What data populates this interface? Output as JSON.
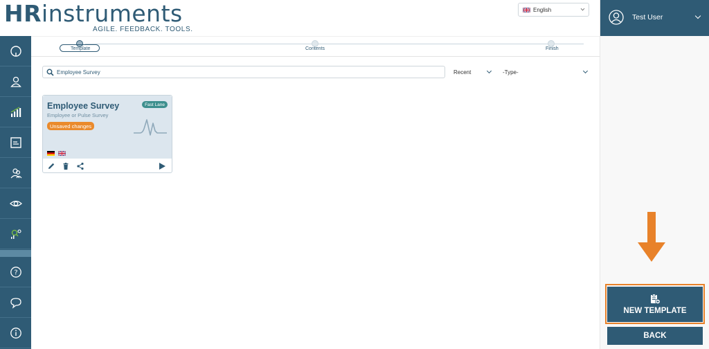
{
  "brand": {
    "logo_text": "HRinstruments",
    "tagline": "AGILE. FEEDBACK. TOOLS.",
    "accent_color": "#e2671b",
    "primary_color": "#2f5b75"
  },
  "language": {
    "selected": "English",
    "flag_icon": "uk-flag-icon"
  },
  "user": {
    "name": "Test User",
    "avatar_icon": "user-avatar-icon"
  },
  "sidebar": {
    "items": [
      {
        "name": "dashboard",
        "icon": "circle-icon"
      },
      {
        "name": "participants",
        "icon": "person-icon"
      },
      {
        "name": "analytics",
        "icon": "bar-chart-icon"
      },
      {
        "name": "surveys",
        "icon": "document-icon"
      },
      {
        "name": "groups",
        "icon": "group-icon"
      },
      {
        "name": "monitor",
        "icon": "eye-icon"
      },
      {
        "name": "insights",
        "icon": "chart-search-icon"
      },
      {
        "name": "help",
        "icon": "question-icon"
      },
      {
        "name": "feedback",
        "icon": "speech-bubble-icon"
      },
      {
        "name": "info",
        "icon": "info-icon"
      }
    ]
  },
  "stepper": {
    "steps": [
      {
        "label": "Template"
      },
      {
        "label": "Contents"
      },
      {
        "label": "Finish"
      }
    ],
    "active_step": 0
  },
  "search": {
    "value": "Employee Survey",
    "sort": "Recent",
    "type_filter": "-Type-"
  },
  "card": {
    "title": "Employee Survey",
    "subtitle": "Employee or Pulse Survey",
    "unsaved_badge": "Unsaved changes",
    "fast_lane_badge": "Fast Lane",
    "languages": [
      "german-flag-icon",
      "uk-flag-icon"
    ],
    "actions": [
      "edit-icon",
      "delete-icon",
      "share-icon",
      "play-icon"
    ]
  },
  "actions": {
    "new_template": "NEW TEMPLATE",
    "back": "BACK",
    "highlight_color": "#e8822a"
  }
}
